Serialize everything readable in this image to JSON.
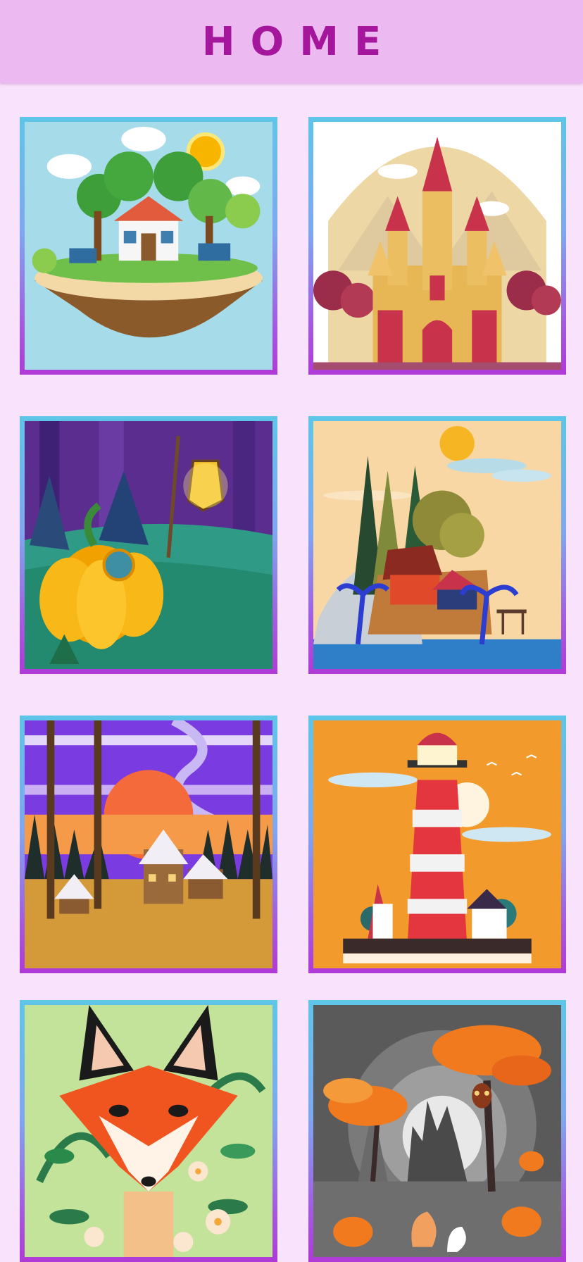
{
  "header": {
    "title": "HOME"
  },
  "gallery": {
    "items": [
      {
        "icon": "floating-island-house-picture"
      },
      {
        "icon": "castle-picture"
      },
      {
        "icon": "pumpkin-house-picture"
      },
      {
        "icon": "island-cabin-picture"
      },
      {
        "icon": "sunset-village-picture"
      },
      {
        "icon": "lighthouse-picture"
      },
      {
        "icon": "fox-picture"
      },
      {
        "icon": "autumn-owl-picture"
      }
    ]
  }
}
